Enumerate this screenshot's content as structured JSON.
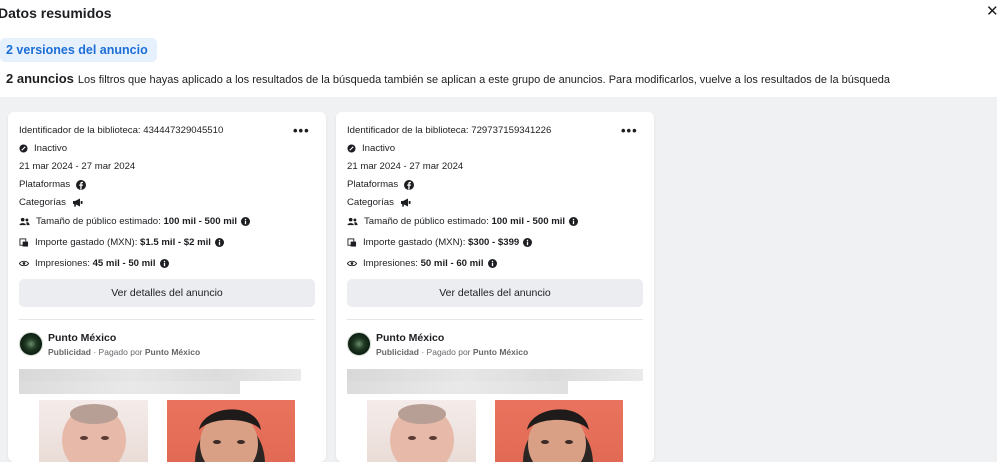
{
  "header": {
    "title": "Datos resumidos",
    "close_icon": "close-icon"
  },
  "versions_pill": "2 versiones del anuncio",
  "summary": {
    "count": "2 anuncios",
    "text": "Los filtros que hayas aplicado a los resultados de la búsqueda también se aplican a este grupo de anuncios. Para modificarlos, vuelve a los resultados de la búsqueda"
  },
  "cards": [
    {
      "library_id": "Identificador de la biblioteca: 434447329045510",
      "status": "Inactivo",
      "dates": "21 mar 2024 - 27 mar 2024",
      "platforms_label": "Plataformas",
      "categories_label": "Categorías",
      "audience_label": "Tamaño de público estimado:",
      "audience_value": "100 mil - 500 mil",
      "spend_label": "Importe gastado (MXN):",
      "spend_value": "$1.5 mil - $2 mil",
      "impressions_label": "Impresiones:",
      "impressions_value": "45 mil - 50 mil",
      "details_button": "Ver detalles del anuncio",
      "page_name": "Punto México",
      "sponsored": "Publicidad",
      "paid_by_prefix": "· Pagado por",
      "paid_by": "Punto México"
    },
    {
      "library_id": "Identificador de la biblioteca: 729737159341226",
      "status": "Inactivo",
      "dates": "21 mar 2024 - 27 mar 2024",
      "platforms_label": "Plataformas",
      "categories_label": "Categorías",
      "audience_label": "Tamaño de público estimado:",
      "audience_value": "100 mil - 500 mil",
      "spend_label": "Importe gastado (MXN):",
      "spend_value": "$300 - $399",
      "impressions_label": "Impresiones:",
      "impressions_value": "50 mil - 60 mil",
      "details_button": "Ver detalles del anuncio",
      "page_name": "Punto México",
      "sponsored": "Publicidad",
      "paid_by_prefix": "· Pagado por",
      "paid_by": "Punto México"
    }
  ],
  "colors": {
    "accent": "#1b6fd6",
    "pill_bg": "#e7f0fd",
    "page_bg": "#f0f1f2"
  }
}
